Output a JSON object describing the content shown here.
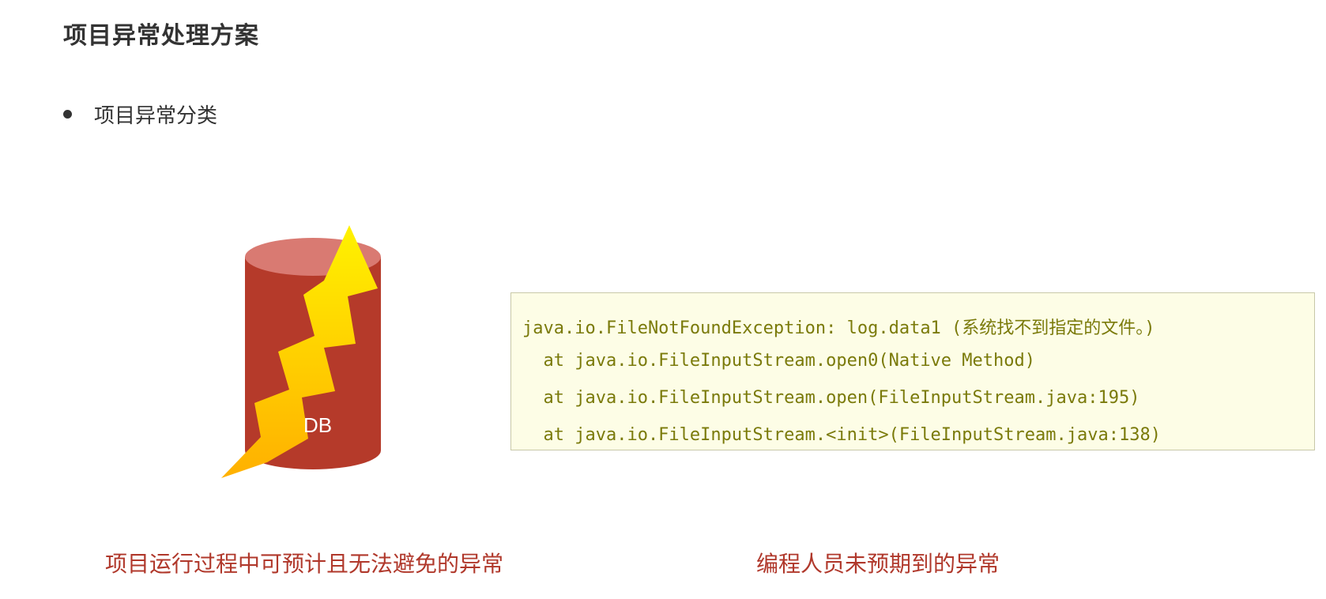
{
  "slide": {
    "title": "项目异常处理方案",
    "bullet": "项目异常分类"
  },
  "figure": {
    "db_label": "DB",
    "colors": {
      "cylinder_body": "#b53a2a",
      "cylinder_top": "#d97a72",
      "lightning_top": "#fff200",
      "lightning_bottom": "#ffb000"
    }
  },
  "code": {
    "lines": [
      "java.io.FileNotFoundException: log.data1 (系统找不到指定的文件。)",
      "  at java.io.FileInputStream.open0(Native Method)",
      "  at java.io.FileInputStream.open(FileInputStream.java:195)",
      "  at java.io.FileInputStream.<init>(FileInputStream.java:138)"
    ]
  },
  "captions": {
    "left": "项目运行过程中可预计且无法避免的异常",
    "right": "编程人员未预期到的异常"
  }
}
